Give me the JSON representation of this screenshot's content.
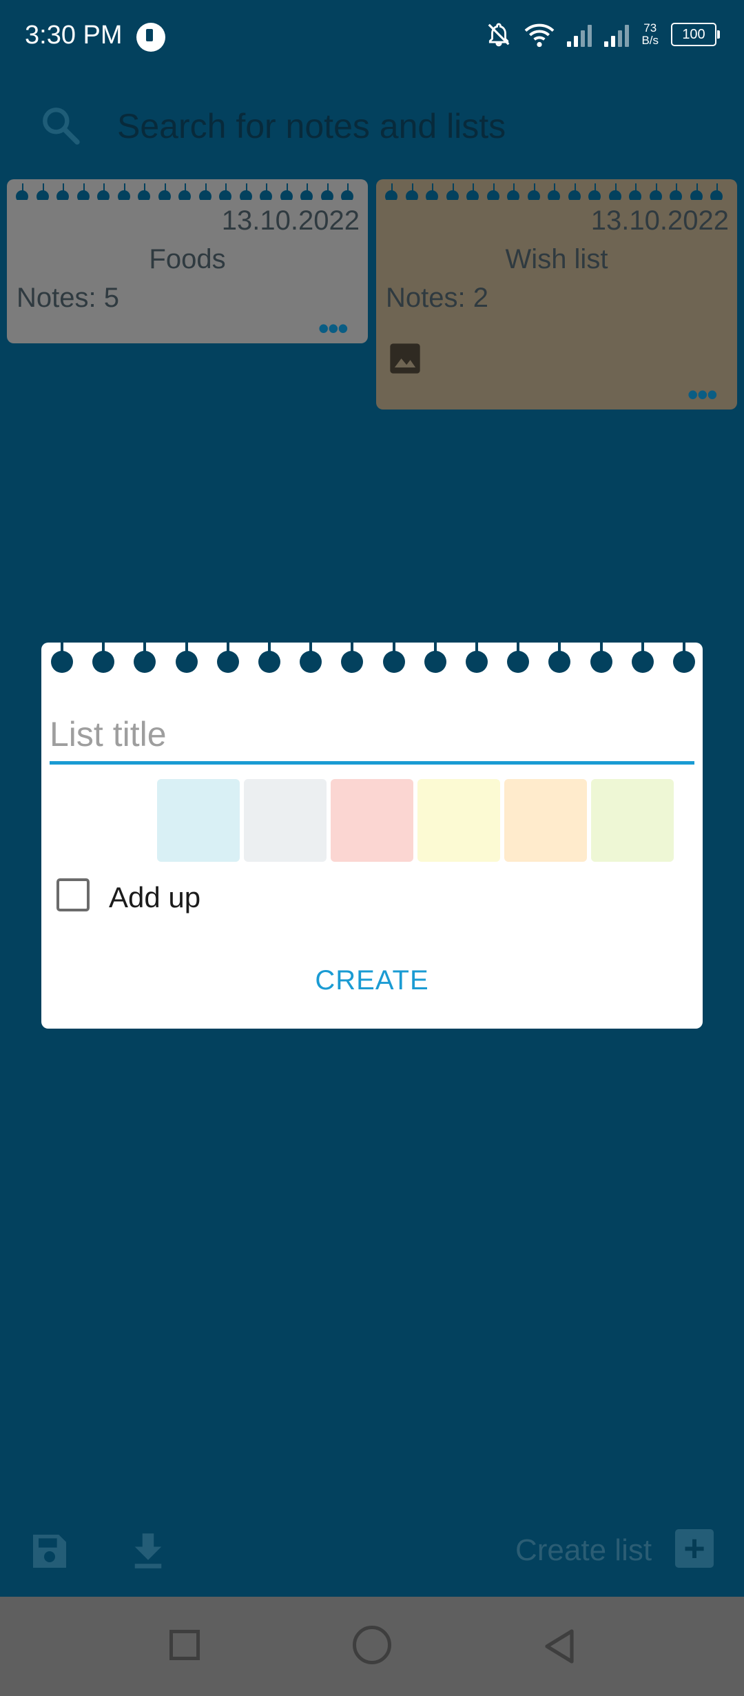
{
  "status_bar": {
    "time": "3:30 PM",
    "net_speed_value": "73",
    "net_speed_unit": "B/s",
    "battery": "100"
  },
  "search": {
    "placeholder": "Search for notes and lists"
  },
  "cards": [
    {
      "date": "13.10.2022",
      "title": "Foods",
      "notes": "Notes: 5",
      "menu": "•••",
      "color": "#7c7c7c"
    },
    {
      "date": "13.10.2022",
      "title": "Wish list",
      "notes": "Notes: 2",
      "menu": "•••",
      "color": "#6f6553",
      "has_image_icon": true
    }
  ],
  "dialog": {
    "title_placeholder": "List title",
    "colors": [
      "#d9f0f5",
      "#eceff1",
      "#fbd6d2",
      "#fcfad3",
      "#ffebcc",
      "#eef7d5"
    ],
    "checkbox_label": "Add up",
    "checkbox_checked": false,
    "create_label": "CREATE"
  },
  "toolbar": {
    "create_list_label": "Create list"
  },
  "colors": {
    "background": "#03415e",
    "accent": "#1a9bd3"
  }
}
